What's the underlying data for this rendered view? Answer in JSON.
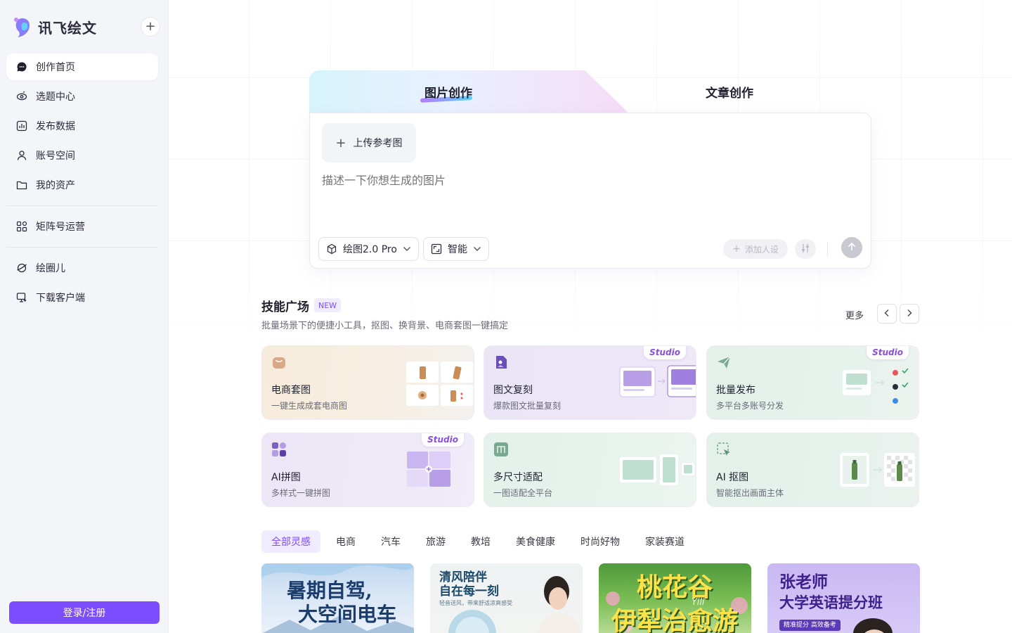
{
  "app": {
    "name": "讯飞绘文"
  },
  "sidebar": {
    "items": [
      {
        "label": "创作首页",
        "icon": "chat-bubble-icon"
      },
      {
        "label": "选题中心",
        "icon": "eye-icon"
      },
      {
        "label": "发布数据",
        "icon": "bar-chart-icon"
      },
      {
        "label": "账号空间",
        "icon": "user-icon"
      },
      {
        "label": "我的资产",
        "icon": "folder-icon"
      },
      {
        "label": "矩阵号运营",
        "icon": "grid-apps-icon"
      },
      {
        "label": "绘圈儿",
        "icon": "circle-planet-icon"
      },
      {
        "label": "下载客户端",
        "icon": "monitor-download-icon"
      }
    ],
    "login_label": "登录/注册"
  },
  "creation": {
    "tab_image": "图片创作",
    "tab_article": "文章创作",
    "upload_label": "上传参考图",
    "prompt_placeholder": "描述一下你想生成的图片",
    "model_label": "绘图2.0 Pro",
    "ratio_label": "智能",
    "persona_label": "添加人设"
  },
  "skills": {
    "title": "技能广场",
    "badge": "NEW",
    "subtitle": "批量场景下的便捷小工具，抠图、换背景、电商套图一键搞定",
    "more_label": "更多",
    "studio_tag": "Studio",
    "cards": [
      {
        "name": "电商套图",
        "desc": "一键生成成套电商图",
        "studio": false
      },
      {
        "name": "图文复刻",
        "desc": "爆款图文批量复刻",
        "studio": true
      },
      {
        "name": "批量发布",
        "desc": "多平台多账号分发",
        "studio": true
      },
      {
        "name": "AI拼图",
        "desc": "多样式一键拼图",
        "studio": true
      },
      {
        "name": "多尺寸适配",
        "desc": "一图适配全平台",
        "studio": false
      },
      {
        "name": "AI 抠图",
        "desc": "智能抠出画面主体",
        "studio": false
      }
    ]
  },
  "categories": {
    "tabs": [
      "全部灵感",
      "电商",
      "汽车",
      "旅游",
      "教培",
      "美食健康",
      "时尚好物",
      "家装赛道"
    ],
    "active": 0
  },
  "gallery": [
    {
      "line1": "暑期自驾,",
      "line2": "大空间电车"
    },
    {
      "line1": "清风陪伴",
      "line2": "自在每一刻",
      "caption": "轻音送风，带来舒适凉爽感受"
    },
    {
      "line1": "桃花谷",
      "line2": "伊犁治愈游",
      "script": "Yili"
    },
    {
      "line1": "张老师",
      "line2": "大学英语提分班",
      "caption": "精准提分 高效备考"
    }
  ],
  "colors": {
    "accent": "#7c4dff",
    "sidebar_bg": "#f4f5f9"
  }
}
